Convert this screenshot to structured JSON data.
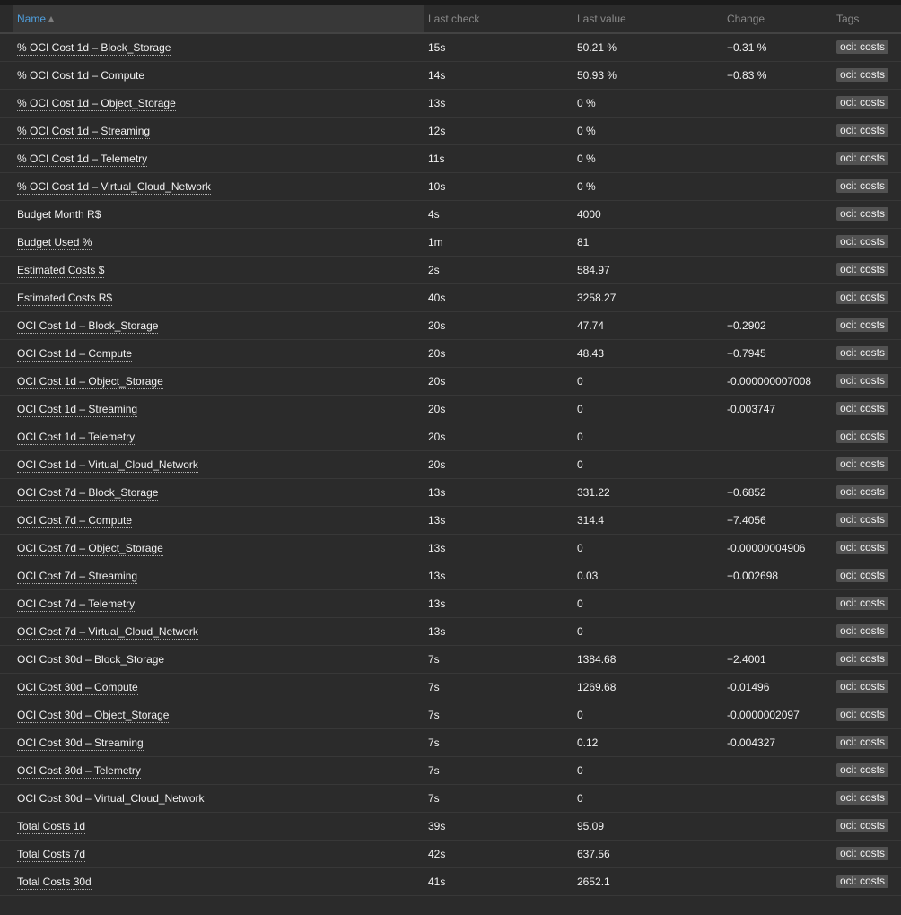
{
  "columns": {
    "name": "Name",
    "last_check": "Last check",
    "last_value": "Last value",
    "change": "Change",
    "tags": "Tags"
  },
  "sort": {
    "column": "name",
    "direction": "ascending"
  },
  "colors": {
    "background": "#2b2b2b",
    "accent_header": "#4f9fde",
    "tag_background": "#525252"
  },
  "rows": [
    {
      "name": "% OCI Cost 1d – Block_Storage",
      "last_check": "15s",
      "last_value": "50.21 %",
      "change": "+0.31 %",
      "tag": "oci: costs"
    },
    {
      "name": "% OCI Cost 1d – Compute",
      "last_check": "14s",
      "last_value": "50.93 %",
      "change": "+0.83 %",
      "tag": "oci: costs"
    },
    {
      "name": "% OCI Cost 1d – Object_Storage",
      "last_check": "13s",
      "last_value": "0 %",
      "change": "",
      "tag": "oci: costs"
    },
    {
      "name": "% OCI Cost 1d – Streaming",
      "last_check": "12s",
      "last_value": "0 %",
      "change": "",
      "tag": "oci: costs"
    },
    {
      "name": "% OCI Cost 1d – Telemetry",
      "last_check": "11s",
      "last_value": "0 %",
      "change": "",
      "tag": "oci: costs"
    },
    {
      "name": "% OCI Cost 1d – Virtual_Cloud_Network",
      "last_check": "10s",
      "last_value": "0 %",
      "change": "",
      "tag": "oci: costs"
    },
    {
      "name": "Budget Month R$",
      "last_check": "4s",
      "last_value": "4000",
      "change": "",
      "tag": "oci: costs"
    },
    {
      "name": "Budget Used %",
      "last_check": "1m",
      "last_value": "81",
      "change": "",
      "tag": "oci: costs"
    },
    {
      "name": "Estimated Costs $",
      "last_check": "2s",
      "last_value": "584.97",
      "change": "",
      "tag": "oci: costs"
    },
    {
      "name": "Estimated Costs R$",
      "last_check": "40s",
      "last_value": "3258.27",
      "change": "",
      "tag": "oci: costs"
    },
    {
      "name": "OCI Cost 1d – Block_Storage",
      "last_check": "20s",
      "last_value": "47.74",
      "change": "+0.2902",
      "tag": "oci: costs"
    },
    {
      "name": "OCI Cost 1d – Compute",
      "last_check": "20s",
      "last_value": "48.43",
      "change": "+0.7945",
      "tag": "oci: costs"
    },
    {
      "name": "OCI Cost 1d – Object_Storage",
      "last_check": "20s",
      "last_value": "0",
      "change": "-0.000000007008",
      "tag": "oci: costs"
    },
    {
      "name": "OCI Cost 1d – Streaming",
      "last_check": "20s",
      "last_value": "0",
      "change": "-0.003747",
      "tag": "oci: costs"
    },
    {
      "name": "OCI Cost 1d – Telemetry",
      "last_check": "20s",
      "last_value": "0",
      "change": "",
      "tag": "oci: costs"
    },
    {
      "name": "OCI Cost 1d – Virtual_Cloud_Network",
      "last_check": "20s",
      "last_value": "0",
      "change": "",
      "tag": "oci: costs"
    },
    {
      "name": "OCI Cost 7d – Block_Storage",
      "last_check": "13s",
      "last_value": "331.22",
      "change": "+0.6852",
      "tag": "oci: costs"
    },
    {
      "name": "OCI Cost 7d – Compute",
      "last_check": "13s",
      "last_value": "314.4",
      "change": "+7.4056",
      "tag": "oci: costs"
    },
    {
      "name": "OCI Cost 7d – Object_Storage",
      "last_check": "13s",
      "last_value": "0",
      "change": "-0.00000004906",
      "tag": "oci: costs"
    },
    {
      "name": "OCI Cost 7d – Streaming",
      "last_check": "13s",
      "last_value": "0.03",
      "change": "+0.002698",
      "tag": "oci: costs"
    },
    {
      "name": "OCI Cost 7d – Telemetry",
      "last_check": "13s",
      "last_value": "0",
      "change": "",
      "tag": "oci: costs"
    },
    {
      "name": "OCI Cost 7d – Virtual_Cloud_Network",
      "last_check": "13s",
      "last_value": "0",
      "change": "",
      "tag": "oci: costs"
    },
    {
      "name": "OCI Cost 30d – Block_Storage",
      "last_check": "7s",
      "last_value": "1384.68",
      "change": "+2.4001",
      "tag": "oci: costs"
    },
    {
      "name": "OCI Cost 30d – Compute",
      "last_check": "7s",
      "last_value": "1269.68",
      "change": "-0.01496",
      "tag": "oci: costs"
    },
    {
      "name": "OCI Cost 30d – Object_Storage",
      "last_check": "7s",
      "last_value": "0",
      "change": "-0.0000002097",
      "tag": "oci: costs"
    },
    {
      "name": "OCI Cost 30d – Streaming",
      "last_check": "7s",
      "last_value": "0.12",
      "change": "-0.004327",
      "tag": "oci: costs"
    },
    {
      "name": "OCI Cost 30d – Telemetry",
      "last_check": "7s",
      "last_value": "0",
      "change": "",
      "tag": "oci: costs"
    },
    {
      "name": "OCI Cost 30d – Virtual_Cloud_Network",
      "last_check": "7s",
      "last_value": "0",
      "change": "",
      "tag": "oci: costs"
    },
    {
      "name": "Total Costs 1d",
      "last_check": "39s",
      "last_value": "95.09",
      "change": "",
      "tag": "oci: costs"
    },
    {
      "name": "Total Costs 7d",
      "last_check": "42s",
      "last_value": "637.56",
      "change": "",
      "tag": "oci: costs"
    },
    {
      "name": "Total Costs 30d",
      "last_check": "41s",
      "last_value": "2652.1",
      "change": "",
      "tag": "oci: costs"
    }
  ]
}
